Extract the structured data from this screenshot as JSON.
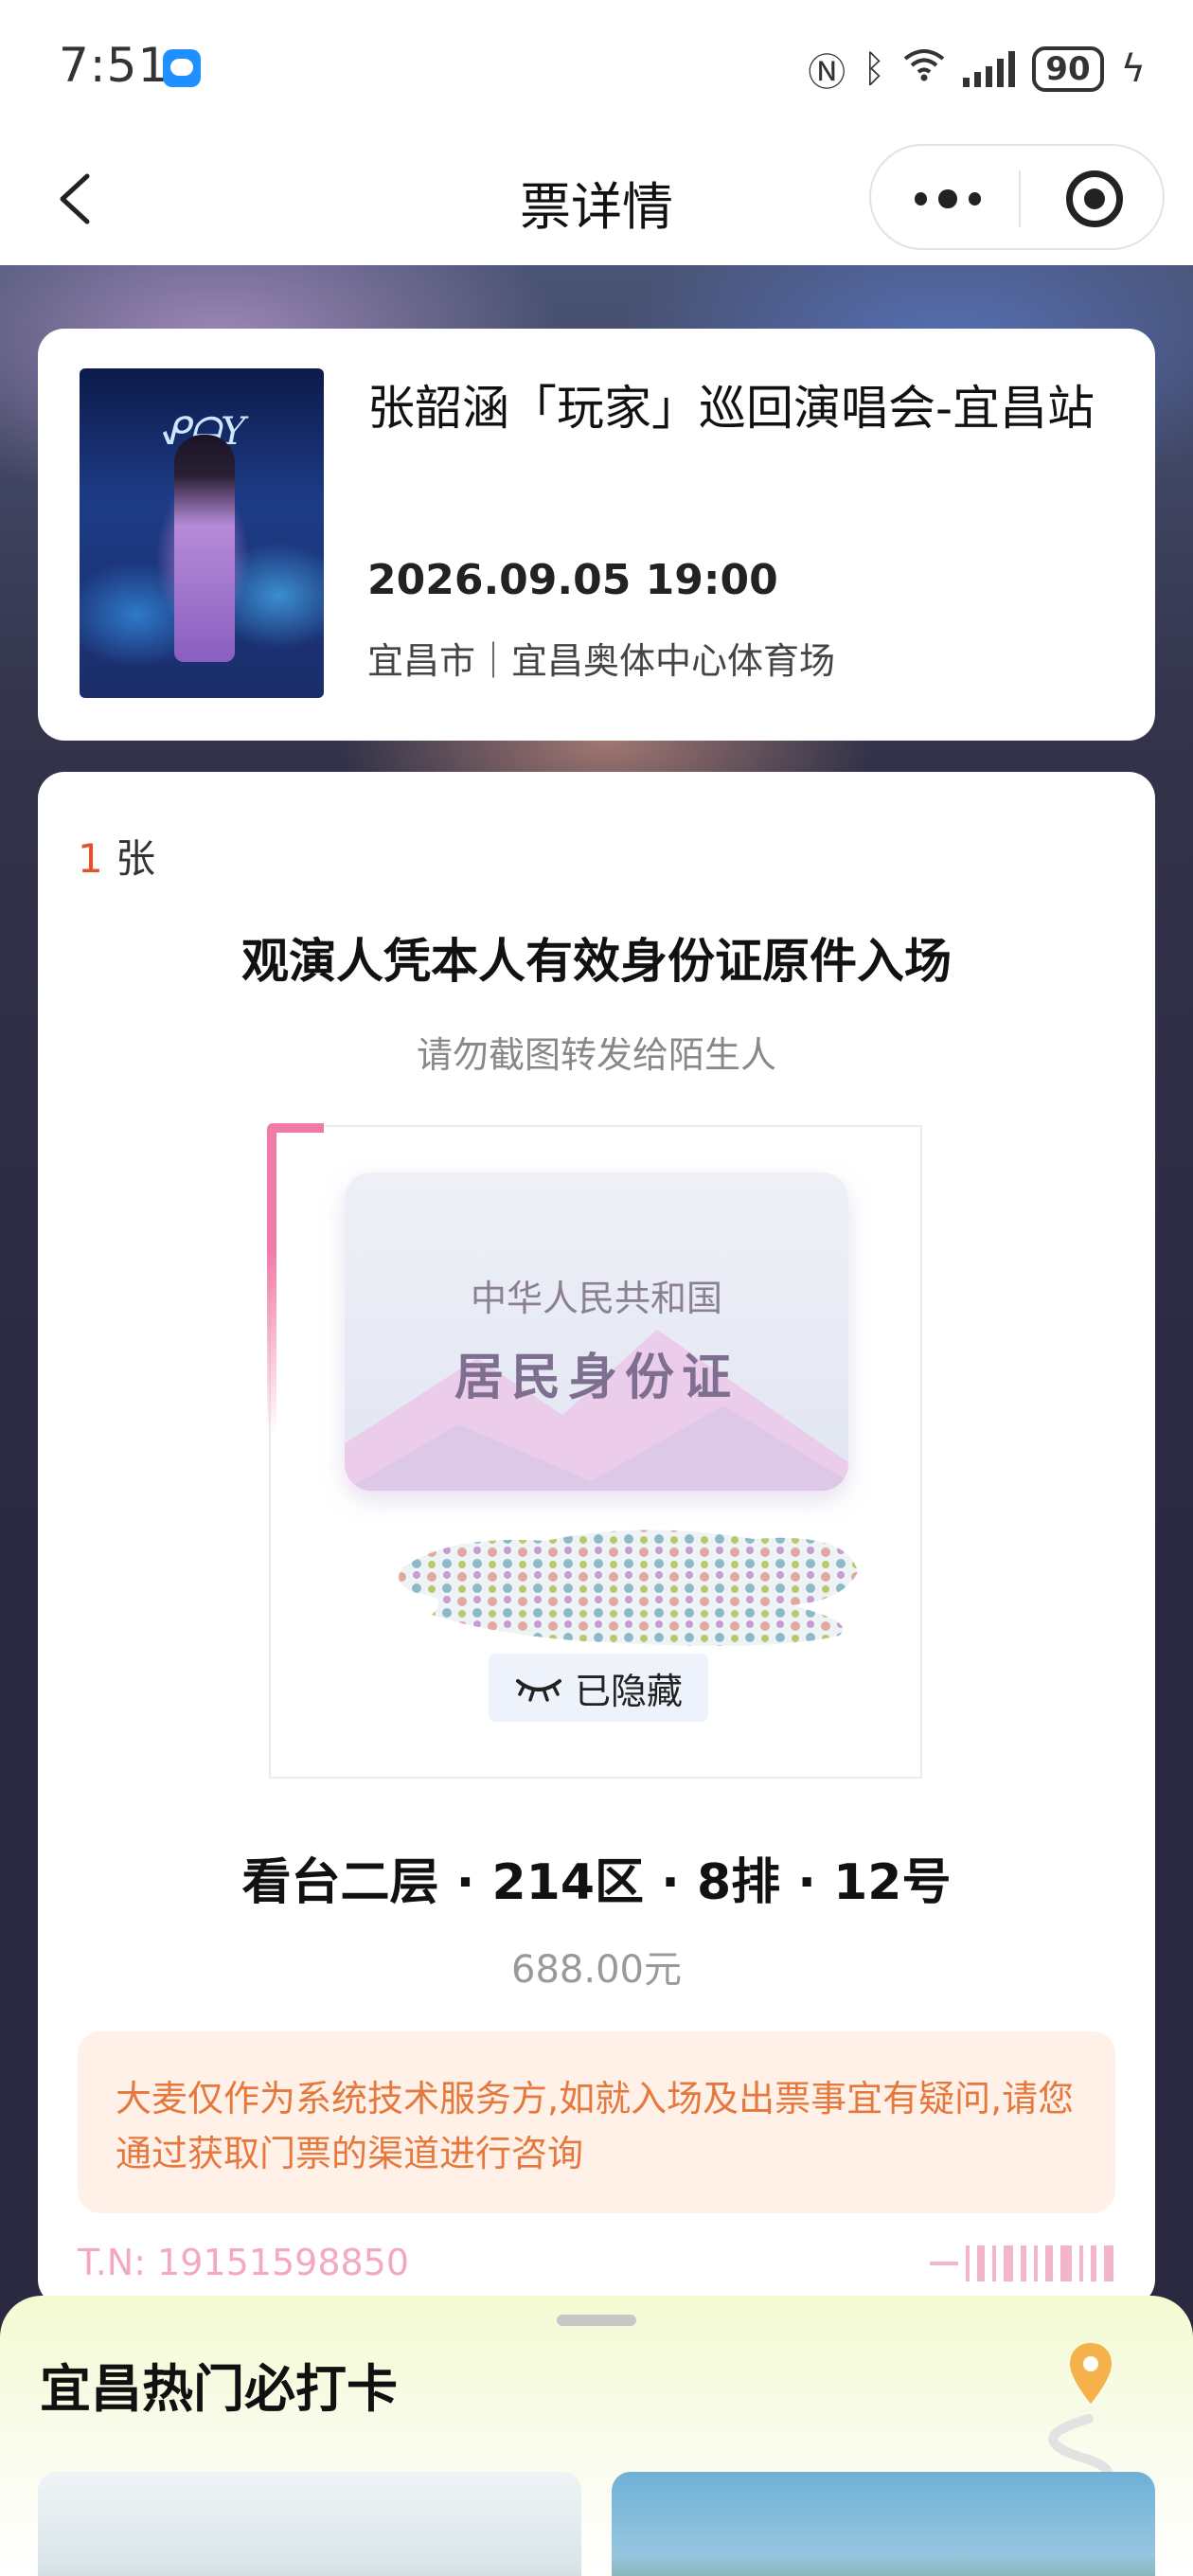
{
  "status_bar": {
    "time": "7:51",
    "battery": "90"
  },
  "nav": {
    "title": "票详情"
  },
  "event": {
    "title": "张韶涵「玩家」巡回演唱会-宜昌站",
    "datetime": "2026.09.05 19:00",
    "venue": "宜昌市｜宜昌奥体中心体育场"
  },
  "ticket": {
    "count_num": "1",
    "count_unit": " 张",
    "entry_rule": "观演人凭本人有效身份证原件入场",
    "warning": "请勿截图转发给陌生人",
    "id_card": {
      "country": "中华人民共和国",
      "label": "居民身份证"
    },
    "hidden_label": "已隐藏",
    "seat": "看台二层 · 214区 · 8排 · 12号",
    "price": "688.00元",
    "notice": "大麦仅作为系统技术服务方,如就入场及出票事宜有疑问,请您通过获取门票的渠道进行咨询",
    "ticket_number": "T.N:  19151598850"
  },
  "bottom_sheet": {
    "title": "宜昌热门必打卡"
  },
  "colors": {
    "accent_red": "#e5502d",
    "notice_text": "#e5783d",
    "notice_bg": "#fff1e8"
  }
}
